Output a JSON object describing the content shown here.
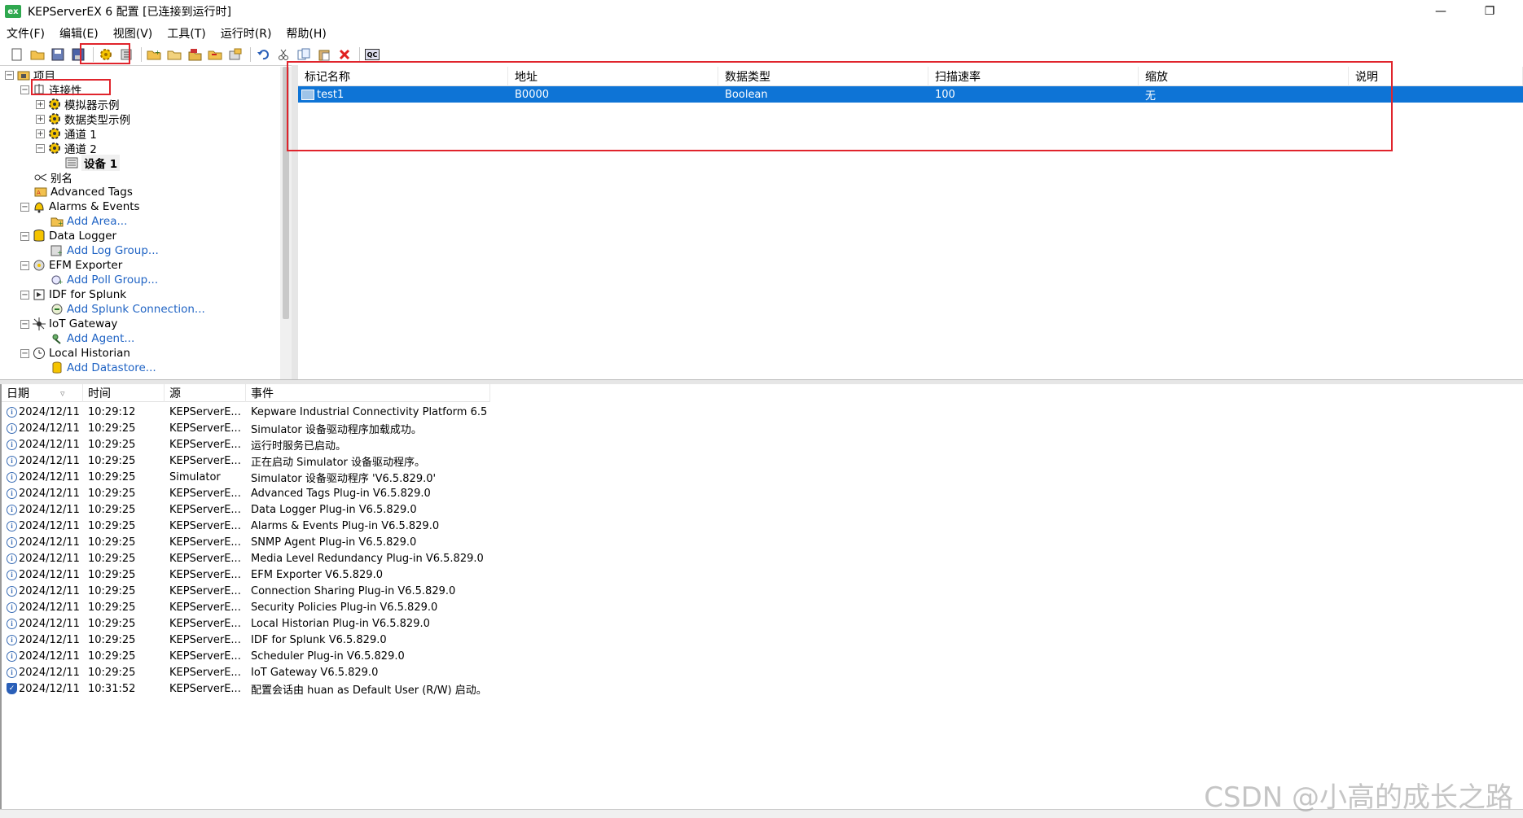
{
  "window": {
    "app_icon": "ex",
    "title": "KEPServerEX 6 配置 [已连接到运行时]",
    "minimize": "—",
    "restore": "❐"
  },
  "menu": [
    "文件(F)",
    "编辑(E)",
    "视图(V)",
    "工具(T)",
    "运行时(R)",
    "帮助(H)"
  ],
  "toolbar": {
    "icons": [
      "new-file-icon",
      "open-folder-icon",
      "save-icon",
      "save-as-icon",
      "new-channel-icon",
      "new-device-icon",
      "new-group-icon",
      "new-tag-icon",
      "bulk-tag-icon",
      "import-icon",
      "properties-icon",
      "undo-icon",
      "cut-icon",
      "copy-icon",
      "paste-icon",
      "delete-icon",
      "quick-client-icon"
    ],
    "quick_client_label": "QC"
  },
  "tree": {
    "project": "项目",
    "connectivity": "连接性",
    "channels": [
      "模拟器示例",
      "数据类型示例",
      "通道 1",
      "通道 2"
    ],
    "device": "设备 1",
    "aliases": "别名",
    "advanced_tags": "Advanced Tags",
    "alarms_events": "Alarms & Events",
    "add_area": "Add Area...",
    "data_logger": "Data Logger",
    "add_log_group": "Add Log Group...",
    "efm_exporter": "EFM Exporter",
    "add_poll_group": "Add Poll Group...",
    "idf_splunk": "IDF for Splunk",
    "add_splunk": "Add Splunk Connection...",
    "iot_gateway": "IoT Gateway",
    "add_agent": "Add Agent...",
    "local_historian": "Local Historian",
    "add_datastore": "Add Datastore..."
  },
  "tag_table": {
    "columns": [
      "标记名称",
      "地址",
      "数据类型",
      "扫描速率",
      "缩放",
      "说明"
    ],
    "rows": [
      {
        "name": "test1",
        "address": "B0000",
        "type": "Boolean",
        "rate": "100",
        "scaling": "无",
        "desc": ""
      }
    ]
  },
  "event_log": {
    "columns": [
      "日期",
      "时间",
      "源",
      "事件"
    ],
    "rows": [
      {
        "date": "2024/12/11",
        "time": "10:29:12",
        "source": "KEPServerE...",
        "event": "Kepware Industrial Connectivity Platform 6.5",
        "icon": "info"
      },
      {
        "date": "2024/12/11",
        "time": "10:29:25",
        "source": "KEPServerE...",
        "event": "Simulator 设备驱动程序加载成功。",
        "icon": "info"
      },
      {
        "date": "2024/12/11",
        "time": "10:29:25",
        "source": "KEPServerE...",
        "event": "运行时服务已启动。",
        "icon": "info"
      },
      {
        "date": "2024/12/11",
        "time": "10:29:25",
        "source": "KEPServerE...",
        "event": "正在启动 Simulator 设备驱动程序。",
        "icon": "info"
      },
      {
        "date": "2024/12/11",
        "time": "10:29:25",
        "source": "Simulator",
        "event": "Simulator 设备驱动程序 'V6.5.829.0'",
        "icon": "info"
      },
      {
        "date": "2024/12/11",
        "time": "10:29:25",
        "source": "KEPServerE...",
        "event": "Advanced Tags Plug-in V6.5.829.0",
        "icon": "info"
      },
      {
        "date": "2024/12/11",
        "time": "10:29:25",
        "source": "KEPServerE...",
        "event": "Data Logger Plug-in V6.5.829.0",
        "icon": "info"
      },
      {
        "date": "2024/12/11",
        "time": "10:29:25",
        "source": "KEPServerE...",
        "event": "Alarms & Events Plug-in V6.5.829.0",
        "icon": "info"
      },
      {
        "date": "2024/12/11",
        "time": "10:29:25",
        "source": "KEPServerE...",
        "event": "SNMP Agent Plug-in V6.5.829.0",
        "icon": "info"
      },
      {
        "date": "2024/12/11",
        "time": "10:29:25",
        "source": "KEPServerE...",
        "event": "Media Level Redundancy Plug-in V6.5.829.0",
        "icon": "info"
      },
      {
        "date": "2024/12/11",
        "time": "10:29:25",
        "source": "KEPServerE...",
        "event": "EFM Exporter V6.5.829.0",
        "icon": "info"
      },
      {
        "date": "2024/12/11",
        "time": "10:29:25",
        "source": "KEPServerE...",
        "event": "Connection Sharing Plug-in V6.5.829.0",
        "icon": "info"
      },
      {
        "date": "2024/12/11",
        "time": "10:29:25",
        "source": "KEPServerE...",
        "event": "Security Policies Plug-in V6.5.829.0",
        "icon": "info"
      },
      {
        "date": "2024/12/11",
        "time": "10:29:25",
        "source": "KEPServerE...",
        "event": "Local Historian Plug-in V6.5.829.0",
        "icon": "info"
      },
      {
        "date": "2024/12/11",
        "time": "10:29:25",
        "source": "KEPServerE...",
        "event": "IDF for Splunk V6.5.829.0",
        "icon": "info"
      },
      {
        "date": "2024/12/11",
        "time": "10:29:25",
        "source": "KEPServerE...",
        "event": "Scheduler Plug-in V6.5.829.0",
        "icon": "info"
      },
      {
        "date": "2024/12/11",
        "time": "10:29:25",
        "source": "KEPServerE...",
        "event": "IoT Gateway V6.5.829.0",
        "icon": "info"
      },
      {
        "date": "2024/12/11",
        "time": "10:31:52",
        "source": "KEPServerE...",
        "event": "配置会话由 huan as Default User (R/W) 启动。",
        "icon": "security"
      }
    ]
  },
  "watermark": "CSDN @小高的成长之路",
  "colors": {
    "selection": "#0e74d6",
    "highlight_box": "#e0242c",
    "link": "#1f63c4"
  }
}
